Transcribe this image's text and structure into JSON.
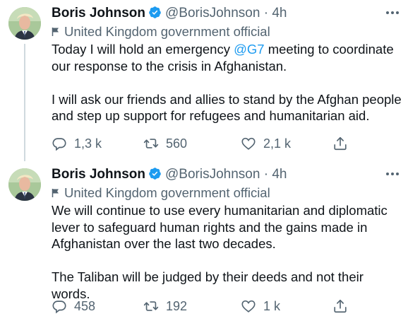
{
  "tweets": [
    {
      "name": "Boris Johnson",
      "handle": "@BorisJohnson",
      "sep": "·",
      "time": "4h",
      "label": "United Kingdom government official",
      "text_before_mention": "Today I will hold an emergency ",
      "mention": "@G7",
      "text_after_mention": " meeting to coordinate our response to the crisis in Afghanistan.",
      "text_para2": "I will ask our friends and allies to stand by the Afghan people and step up support for refugees and humanitarian aid.",
      "replies": "1,3 k",
      "retweets": "560",
      "likes": "2,1 k"
    },
    {
      "name": "Boris Johnson",
      "handle": "@BorisJohnson",
      "sep": "·",
      "time": "4h",
      "label": "United Kingdom government official",
      "text_para1": "We will continue to use every humanitarian and diplomatic lever to safeguard human rights and the gains made in Afghanistan over the last two decades.",
      "text_para2": "The Taliban will be judged by their deeds and not their words.",
      "replies": "458",
      "retweets": "192",
      "likes": "1 k"
    }
  ],
  "icons": {
    "verified": "verified-badge-icon",
    "more": "more-dots-icon",
    "label": "flag-icon",
    "reply": "reply-icon",
    "retweet": "retweet-icon",
    "like": "heart-icon",
    "share": "share-icon"
  },
  "colors": {
    "accent": "#1d9bf0",
    "secondary_text": "#536471",
    "primary_text": "#0f1419",
    "thread_line": "#cfd9de"
  }
}
